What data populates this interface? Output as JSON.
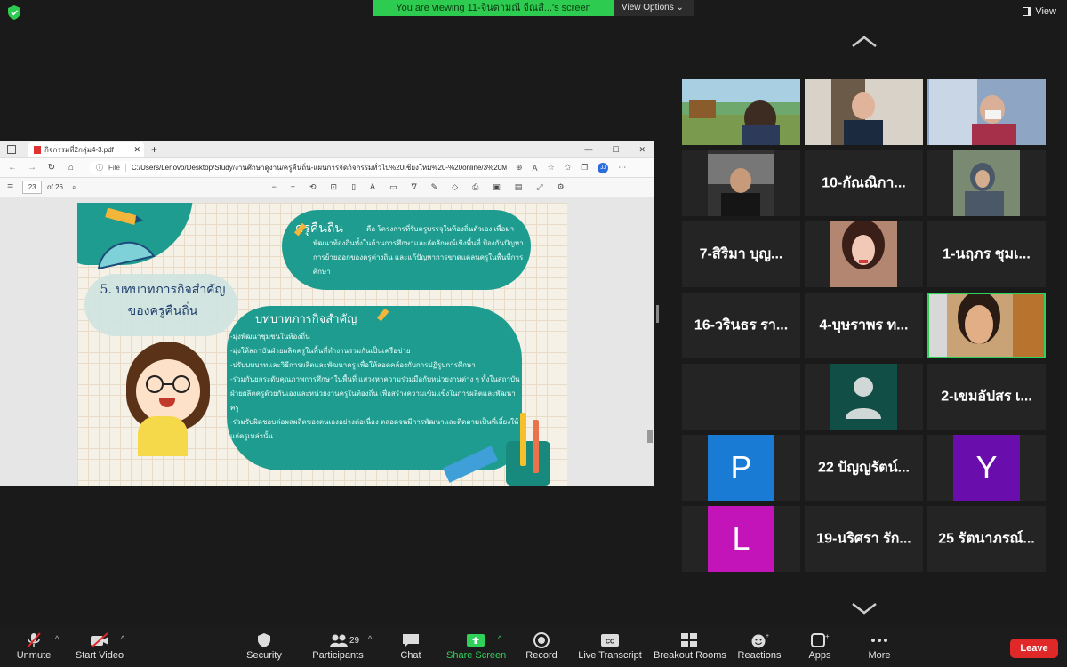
{
  "top": {
    "banner": "You are viewing 11-จินตามณี จีณสี...'s screen",
    "view_options": "View Options",
    "view": "View"
  },
  "browser": {
    "tab_title": "กิจกรรมที่2กลุ่ม4-3.pdf",
    "new_tab": "+",
    "file_label": "File",
    "url": "C:/Users/Lenovo/Desktop/Study/งานศึกษาดูงาน/ครูคืนถิ่น-แผนการจัดกิจกรรมทั่วไป%20เชียงใหม่%20-%20online/3%20May%202022/กิจกร...",
    "page": "23",
    "page_of": "of 26"
  },
  "slide": {
    "title_line1": "5. บทบาทภารกิจสำคัญ",
    "title_line2": "ของครูคืนถิ่น",
    "top_head": "ครูคืนถิ่น",
    "top_body": "คือ โครงการที่รับครูบรรจุในท้องถิ่นตัวเอง เพื่อมาพัฒนาท้องถิ่นทั้งในด้านการศึกษาและอัตลักษณ์เชิงพื้นที่ ป้องกันปัญหาการย้ายออกของครูต่างถิ่น และแก้ปัญหาการขาดแคลนครูในพื้นที่การศึกษา",
    "main_head": "บทบาทภารกิจสำคัญ",
    "main_items": [
      "-มุ่งพัฒนาชุมชนในท้องถิ่น",
      "-มุ่งให้สถาบันฝ่ายผลิตครูในพื้นที่ทำงานรวมกันเป็นเครือข่าย",
      "-ปรับบทบาทและวิธีการผลิตและพัฒนาครู เพื่อให้สอดคล้องกับการปฏิรูปการศึกษา",
      "-ร่วมกันยกระดับคุณภาพการศึกษาในพื้นที่ แสวงหาความร่วมมือกับหน่วยงานต่าง ๆ ทั้งในสถาบันฝ่ายผลิตครูด้วยกันเองและหน่วยงานครูในท้องถิ่น เพื่อสร้างความเข้มแข็งในการผลิตและพัฒนาครู",
      "-ร่วมรับผิดชอบต่อผลผลิตของตนเองอย่างต่อเนื่อง ตลอดจนมีการพัฒนาและติดตามเป็นพี่เลี้ยงให้แก่ครูเหล่านั้น"
    ]
  },
  "participants": {
    "tiles": [
      {
        "name": ""
      },
      {
        "name": ""
      },
      {
        "name": ""
      },
      {
        "name": ""
      },
      {
        "name": "10-กัณณิกา..."
      },
      {
        "name": ""
      },
      {
        "name": "7-สิริมา บุญ..."
      },
      {
        "name": ""
      },
      {
        "name": "1-นฤภร ชุมเ..."
      },
      {
        "name": "16-วรินธร รา..."
      },
      {
        "name": "4-บุษราพร ท..."
      },
      {
        "name": ""
      },
      {
        "name": ""
      },
      {
        "name": ""
      },
      {
        "name": "2-เขมอัปสร เ..."
      },
      {
        "name": "",
        "initial": "P",
        "color": "#1a7bd4"
      },
      {
        "name": "22 ปัญญรัตน์..."
      },
      {
        "name": "",
        "initial": "Y",
        "color": "#6a0dad"
      },
      {
        "name": "",
        "initial": "L",
        "color": "#c214b9"
      },
      {
        "name": "19-นริศรา รัก..."
      },
      {
        "name": "25 รัตนาภรณ์..."
      }
    ]
  },
  "toolbar": {
    "unmute": "Unmute",
    "start_video": "Start Video",
    "security": "Security",
    "participants": "Participants",
    "participants_count": "29",
    "chat": "Chat",
    "share_screen": "Share Screen",
    "record": "Record",
    "live_transcript": "Live Transcript",
    "breakout_rooms": "Breakout Rooms",
    "reactions": "Reactions",
    "apps": "Apps",
    "more": "More",
    "leave": "Leave"
  },
  "colors": {
    "banner_green": "#2dcb4f",
    "active_speaker": "#2fd15a",
    "leave_red": "#e02828",
    "slide_teal": "#1e9c8f"
  }
}
